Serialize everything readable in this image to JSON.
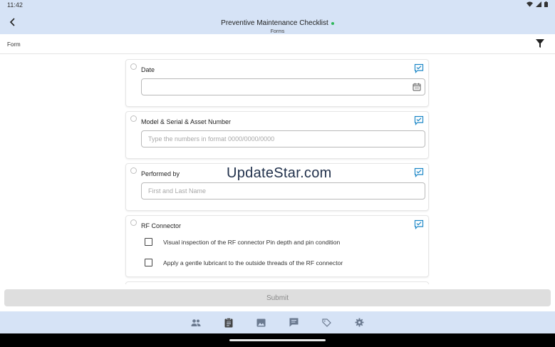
{
  "status_bar": {
    "time": "11:42"
  },
  "app_bar": {
    "title": "Preventive Maintenance Checklist",
    "subtitle": "Forms",
    "online_color": "#2fb85a"
  },
  "sub_bar": {
    "label": "Form",
    "filter_icon": "filter-icon"
  },
  "questions": {
    "date": {
      "label": "Date",
      "value": "",
      "placeholder": ""
    },
    "model": {
      "label": "Model & Serial & Asset Number",
      "value": "",
      "placeholder": "Type the numbers in format 0000/0000/0000"
    },
    "performed_by": {
      "label": "Performed by",
      "value": "",
      "placeholder": "First and Last Name"
    },
    "rf_connector": {
      "label": "RF Connector",
      "options": [
        {
          "label": "Visual inspection of the RF connector Pin depth and pin condition",
          "checked": false
        },
        {
          "label": "Apply a gentle lubricant to the outside threads of the RF connector",
          "checked": false
        }
      ]
    }
  },
  "watermark": "UpdateStar.com",
  "submit_label": "Submit",
  "bottom_nav": [
    "people-icon",
    "clipboard-icon",
    "image-icon",
    "chat-icon",
    "tag-icon",
    "settings-icon"
  ],
  "colors": {
    "bar": "#d6e3f6",
    "accent": "#1e88c7",
    "submit_bg": "#dedede"
  }
}
